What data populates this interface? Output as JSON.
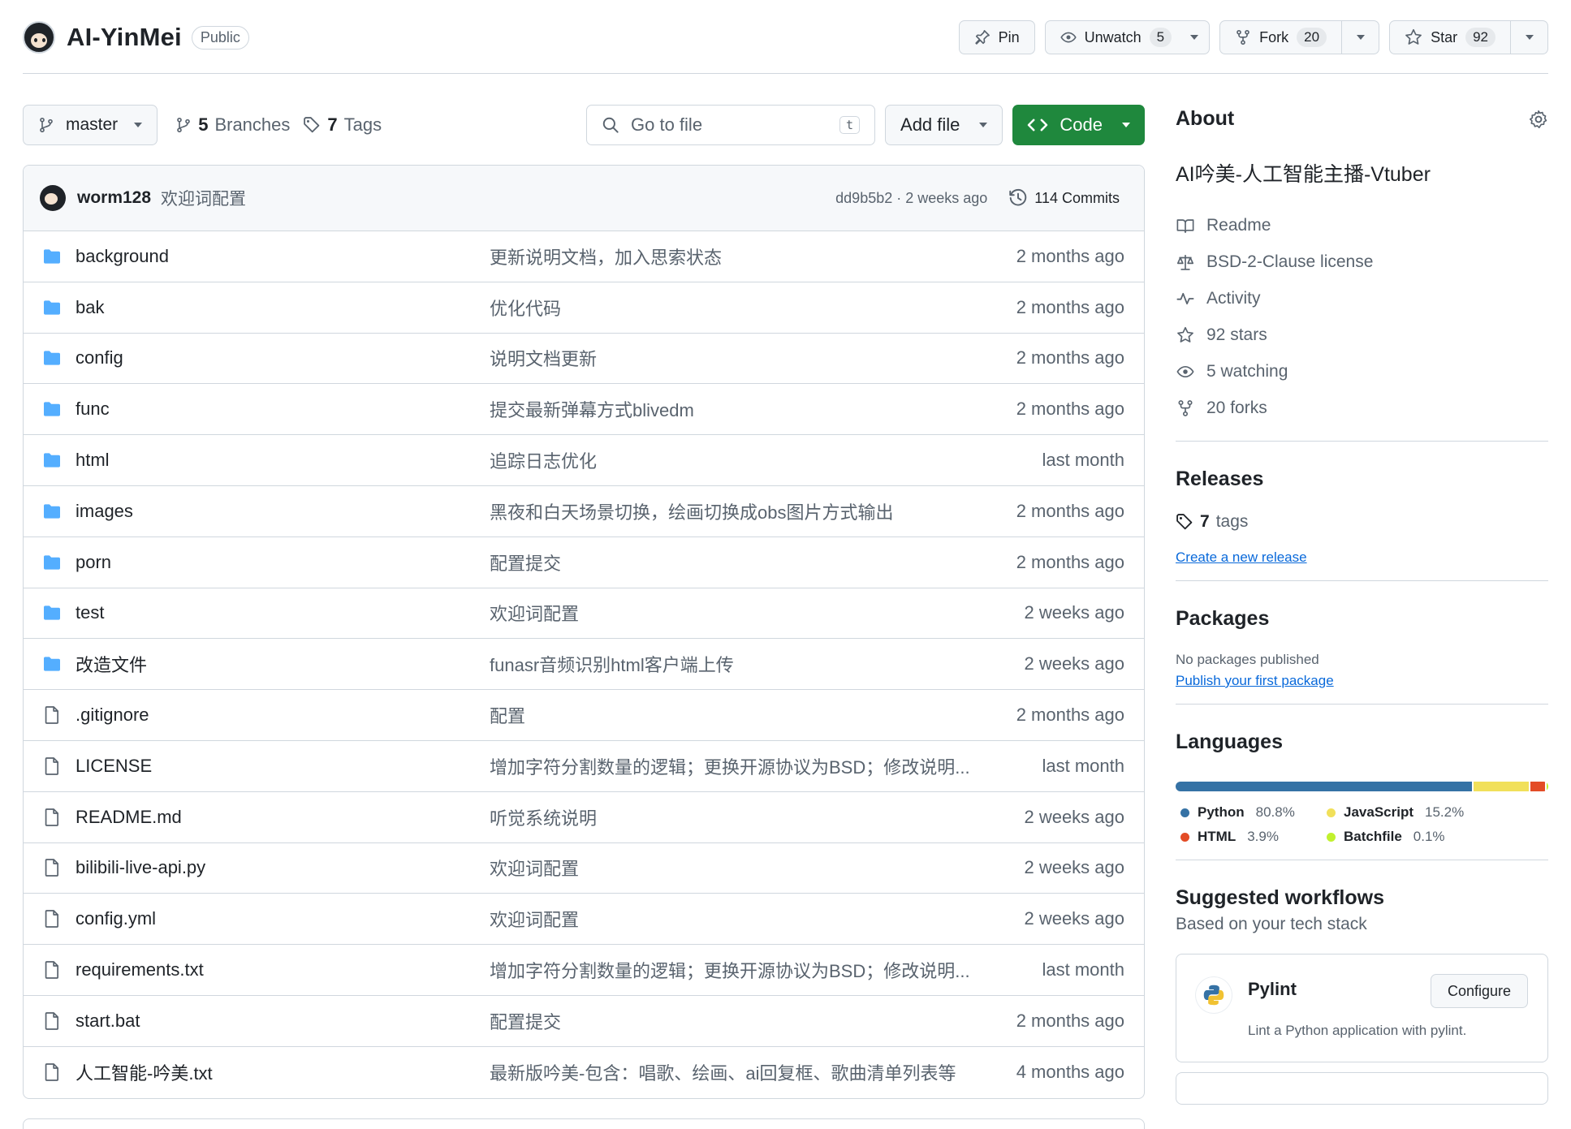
{
  "repo": {
    "name": "AI-YinMei",
    "visibility": "Public",
    "pin_label": "Pin",
    "watch_label": "Unwatch",
    "watch_count": "5",
    "fork_label": "Fork",
    "fork_count": "20",
    "star_label": "Star",
    "star_count": "92"
  },
  "toolbar": {
    "branch": "master",
    "branches_count": "5",
    "branches_label": "Branches",
    "tags_count": "7",
    "tags_label": "Tags",
    "goto_placeholder": "Go to file",
    "goto_shortcut": "t",
    "add_file": "Add file",
    "code": "Code"
  },
  "commit": {
    "author": "worm128",
    "message": "欢迎词配置",
    "meta": "dd9b5b2 · 2 weeks ago",
    "commits_count": "114 Commits"
  },
  "files": [
    {
      "type": "dir",
      "name": "background",
      "message": "更新说明文档，加入思索状态",
      "date": "2 months ago"
    },
    {
      "type": "dir",
      "name": "bak",
      "message": "优化代码",
      "date": "2 months ago"
    },
    {
      "type": "dir",
      "name": "config",
      "message": "说明文档更新",
      "date": "2 months ago"
    },
    {
      "type": "dir",
      "name": "func",
      "message": "提交最新弹幕方式blivedm",
      "date": "2 months ago"
    },
    {
      "type": "dir",
      "name": "html",
      "message": "追踪日志优化",
      "date": "last month"
    },
    {
      "type": "dir",
      "name": "images",
      "message": "黑夜和白天场景切换，绘画切换成obs图片方式输出",
      "date": "2 months ago"
    },
    {
      "type": "dir",
      "name": "porn",
      "message": "配置提交",
      "date": "2 months ago"
    },
    {
      "type": "dir",
      "name": "test",
      "message": "欢迎词配置",
      "date": "2 weeks ago"
    },
    {
      "type": "dir",
      "name": "改造文件",
      "message": "funasr音频识别html客户端上传",
      "date": "2 weeks ago"
    },
    {
      "type": "file",
      "name": ".gitignore",
      "message": "配置",
      "date": "2 months ago"
    },
    {
      "type": "file",
      "name": "LICENSE",
      "message": "增加字符分割数量的逻辑；更换开源协议为BSD；修改说明...",
      "date": "last month"
    },
    {
      "type": "file",
      "name": "README.md",
      "message": "听觉系统说明",
      "date": "2 weeks ago"
    },
    {
      "type": "file",
      "name": "bilibili-live-api.py",
      "message": "欢迎词配置",
      "date": "2 weeks ago"
    },
    {
      "type": "file",
      "name": "config.yml",
      "message": "欢迎词配置",
      "date": "2 weeks ago"
    },
    {
      "type": "file",
      "name": "requirements.txt",
      "message": "增加字符分割数量的逻辑；更换开源协议为BSD；修改说明...",
      "date": "last month"
    },
    {
      "type": "file",
      "name": "start.bat",
      "message": "配置提交",
      "date": "2 months ago"
    },
    {
      "type": "file",
      "name": "人工智能-吟美.txt",
      "message": "最新版吟美-包含：唱歌、绘画、ai回复框、歌曲清单列表等",
      "date": "4 months ago"
    }
  ],
  "about": {
    "title": "About",
    "description": "AI吟美-人工智能主播-Vtuber",
    "items": [
      {
        "icon": "book-icon",
        "label": "Readme"
      },
      {
        "icon": "scale-icon",
        "label": "BSD-2-Clause license"
      },
      {
        "icon": "pulse-icon",
        "label": "Activity"
      },
      {
        "icon": "star-icon",
        "label": "92 stars"
      },
      {
        "icon": "eye-icon",
        "label": "5 watching"
      },
      {
        "icon": "fork-icon",
        "label": "20 forks"
      }
    ]
  },
  "releases": {
    "title": "Releases",
    "tags_count": "7",
    "tags_label": "tags",
    "create_link": "Create a new release"
  },
  "packages": {
    "title": "Packages",
    "empty": "No packages published",
    "publish_link": "Publish your first package"
  },
  "languages": {
    "title": "Languages",
    "items": [
      {
        "name": "Python",
        "percent": "80.8%",
        "value": 80.8,
        "color": "#3572A5"
      },
      {
        "name": "JavaScript",
        "percent": "15.2%",
        "value": 15.2,
        "color": "#f1e05a"
      },
      {
        "name": "HTML",
        "percent": "3.9%",
        "value": 3.9,
        "color": "#e34c26"
      },
      {
        "name": "Batchfile",
        "percent": "0.1%",
        "value": 0.1,
        "color": "#C1F12E"
      }
    ]
  },
  "workflows": {
    "title": "Suggested workflows",
    "subtitle": "Based on your tech stack",
    "card_title": "Pylint",
    "card_desc": "Lint a Python application with pylint.",
    "configure": "Configure"
  },
  "colors": {
    "accent": "#0969da",
    "code_button": "#1f883d",
    "folder": "#54aeff"
  }
}
